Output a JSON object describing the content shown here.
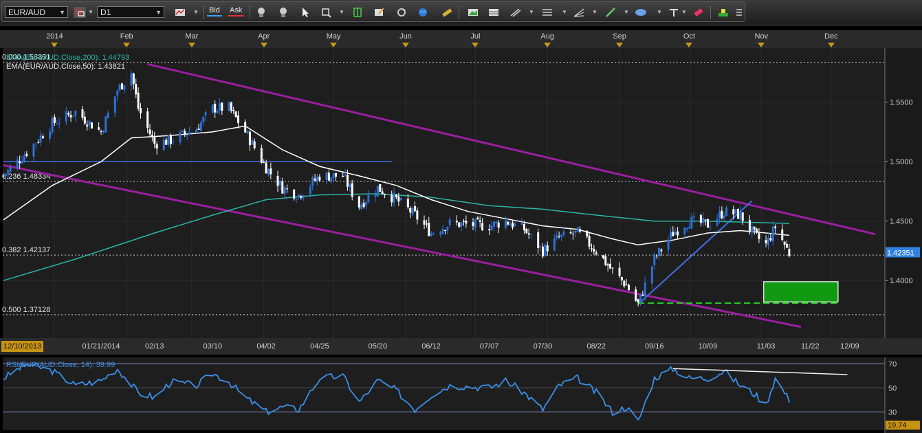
{
  "toolbar": {
    "symbol": "EUR/AUD",
    "timeframe": "D1",
    "bid_label": "Bid",
    "ask_label": "Ask"
  },
  "top_axis": {
    "months": [
      "2014",
      "Feb",
      "Mar",
      "Apr",
      "May",
      "Jun",
      "Jul",
      "Aug",
      "Sep",
      "Oct",
      "Nov",
      "Dec"
    ]
  },
  "bottom_axis": {
    "first_date": "12/10/2013",
    "dates": [
      "01/21/2014",
      "02/13",
      "03/10",
      "04/02",
      "04/25",
      "05/20",
      "06/12",
      "07/07",
      "07/30",
      "08/22",
      "09/16",
      "10/09",
      "11/03",
      "11/22",
      "12/09"
    ]
  },
  "colors": {
    "bull_candle": "#2d6fd6",
    "bear_candle": "#ffffff",
    "ema_50": "#ffffff",
    "ema_200": "#2bb5a8",
    "channel": "#9b1ea0",
    "trendline": "#3f6fe6",
    "rsi": "#3a8fe8",
    "target_box": "#119a11",
    "target_line": "#22cc22",
    "price_tag": "#2f82e0",
    "rsi_tag": "#c79313"
  },
  "chart_data": [
    {
      "type": "candlestick",
      "symbol": "EUR/AUD",
      "timeframe": "D1",
      "ylim": [
        1.355,
        1.592
      ],
      "y_ticks": [
        1.4,
        1.45,
        1.5,
        1.55
      ],
      "y_tick_labels": [
        "1.4000",
        "1.4500",
        "1.5000",
        "1.5500"
      ],
      "last_price": 1.42351,
      "last_price_label": "1.42351",
      "indicators": [
        {
          "name": "EMA(EUR/AUD.Close,200)",
          "label": "EMA(EUR/AUD.Close,200): 1.44793",
          "last": 1.44793
        },
        {
          "name": "EMA(EUR/AUD.Close,50)",
          "label": "EMA(EUR/AUD.Close,50): 1.43821",
          "last": 1.43821
        }
      ],
      "fib_levels": [
        {
          "label": "0.000 1.58351",
          "value": 1.58351
        },
        {
          "label": "0.236 1.48334",
          "value": 1.48334
        },
        {
          "label": "0.382 1.42137",
          "value": 1.42137
        },
        {
          "label": "0.500 1.37128",
          "value": 1.37128
        }
      ],
      "close_path": [
        [
          "2013-12-10",
          1.488
        ],
        [
          "2013-12-20",
          1.508
        ],
        [
          "2013-12-31",
          1.532
        ],
        [
          "2014-01-10",
          1.542
        ],
        [
          "2014-01-21",
          1.525
        ],
        [
          "2014-01-28",
          1.56
        ],
        [
          "2014-02-03",
          1.575
        ],
        [
          "2014-02-06",
          1.545
        ],
        [
          "2014-02-13",
          1.515
        ],
        [
          "2014-02-20",
          1.518
        ],
        [
          "2014-03-03",
          1.528
        ],
        [
          "2014-03-10",
          1.545
        ],
        [
          "2014-03-17",
          1.545
        ],
        [
          "2014-03-24",
          1.525
        ],
        [
          "2014-04-02",
          1.495
        ],
        [
          "2014-04-09",
          1.478
        ],
        [
          "2014-04-16",
          1.472
        ],
        [
          "2014-04-25",
          1.488
        ],
        [
          "2014-05-05",
          1.488
        ],
        [
          "2014-05-12",
          1.463
        ],
        [
          "2014-05-20",
          1.478
        ],
        [
          "2014-05-28",
          1.468
        ],
        [
          "2014-06-05",
          1.455
        ],
        [
          "2014-06-12",
          1.44
        ],
        [
          "2014-06-20",
          1.448
        ],
        [
          "2014-07-07",
          1.446
        ],
        [
          "2014-07-14",
          1.45
        ],
        [
          "2014-07-22",
          1.443
        ],
        [
          "2014-07-30",
          1.425
        ],
        [
          "2014-08-06",
          1.436
        ],
        [
          "2014-08-14",
          1.44
        ],
        [
          "2014-08-22",
          1.425
        ],
        [
          "2014-08-29",
          1.408
        ],
        [
          "2014-09-04",
          1.396
        ],
        [
          "2014-09-09",
          1.38
        ],
        [
          "2014-09-16",
          1.418
        ],
        [
          "2014-09-24",
          1.44
        ],
        [
          "2014-10-01",
          1.45
        ],
        [
          "2014-10-09",
          1.447
        ],
        [
          "2014-10-16",
          1.458
        ],
        [
          "2014-10-23",
          1.455
        ],
        [
          "2014-10-29",
          1.438
        ],
        [
          "2014-11-03",
          1.43
        ],
        [
          "2014-11-07",
          1.445
        ],
        [
          "2014-11-13",
          1.423
        ]
      ],
      "ema50_path": [
        [
          "2013-12-10",
          1.451
        ],
        [
          "2013-12-31",
          1.48
        ],
        [
          "2014-01-21",
          1.5
        ],
        [
          "2014-02-03",
          1.52
        ],
        [
          "2014-02-20",
          1.522
        ],
        [
          "2014-03-10",
          1.525
        ],
        [
          "2014-03-24",
          1.53
        ],
        [
          "2014-04-09",
          1.51
        ],
        [
          "2014-04-25",
          1.496
        ],
        [
          "2014-05-12",
          1.488
        ],
        [
          "2014-05-28",
          1.48
        ],
        [
          "2014-06-12",
          1.468
        ],
        [
          "2014-06-28",
          1.458
        ],
        [
          "2014-07-14",
          1.452
        ],
        [
          "2014-07-30",
          1.446
        ],
        [
          "2014-08-14",
          1.443
        ],
        [
          "2014-08-29",
          1.435
        ],
        [
          "2014-09-09",
          1.43
        ],
        [
          "2014-09-24",
          1.434
        ],
        [
          "2014-10-09",
          1.44
        ],
        [
          "2014-10-23",
          1.442
        ],
        [
          "2014-11-03",
          1.44
        ],
        [
          "2014-11-13",
          1.438
        ]
      ],
      "ema200_path": [
        [
          "2013-12-10",
          1.4
        ],
        [
          "2014-01-10",
          1.418
        ],
        [
          "2014-02-13",
          1.44
        ],
        [
          "2014-03-10",
          1.455
        ],
        [
          "2014-04-02",
          1.468
        ],
        [
          "2014-04-25",
          1.472
        ],
        [
          "2014-05-20",
          1.473
        ],
        [
          "2014-06-12",
          1.47
        ],
        [
          "2014-07-07",
          1.463
        ],
        [
          "2014-07-30",
          1.46
        ],
        [
          "2014-08-22",
          1.455
        ],
        [
          "2014-09-16",
          1.45
        ],
        [
          "2014-10-09",
          1.45
        ],
        [
          "2014-11-13",
          1.448
        ]
      ],
      "channel_lines": [
        {
          "from": [
            "2014-02-10",
            1.582
          ],
          "to": [
            "2014-12-20",
            1.439
          ]
        },
        {
          "from": [
            "2013-12-10",
            1.497
          ],
          "to": [
            "2014-11-18",
            1.361
          ]
        }
      ],
      "horizontal_line": {
        "from": [
          "2013-12-10",
          1.5
        ],
        "to": [
          "2014-05-26",
          1.5
        ]
      },
      "trendline": {
        "from": [
          "2014-09-09",
          1.38
        ],
        "to": [
          "2014-10-28",
          1.467
        ]
      },
      "target_zone": {
        "x": [
          "2014-11-02",
          "2014-12-04"
        ],
        "y": [
          1.382,
          1.399
        ]
      },
      "target_line": {
        "x": [
          "2014-09-09",
          "2014-12-05"
        ],
        "y": 1.381
      }
    },
    {
      "type": "line",
      "indicator": "RSI(EUR/AUD.Close, 14)",
      "label": "RSI(EUR/AUD.Close, 14): 39.99",
      "last": 39.99,
      "ylim": [
        17,
        73
      ],
      "levels": [
        70,
        50,
        30
      ],
      "level_labels": [
        "70",
        "50",
        "30"
      ],
      "min_label": "19.74",
      "rsi_path": [
        [
          "2013-12-10",
          58
        ],
        [
          "2013-12-20",
          70
        ],
        [
          "2013-12-31",
          64
        ],
        [
          "2014-01-10",
          52
        ],
        [
          "2014-01-21",
          56
        ],
        [
          "2014-01-28",
          66
        ],
        [
          "2014-02-06",
          46
        ],
        [
          "2014-02-13",
          42
        ],
        [
          "2014-02-20",
          55
        ],
        [
          "2014-03-03",
          52
        ],
        [
          "2014-03-10",
          62
        ],
        [
          "2014-03-17",
          55
        ],
        [
          "2014-03-24",
          42
        ],
        [
          "2014-04-02",
          30
        ],
        [
          "2014-04-09",
          34
        ],
        [
          "2014-04-16",
          32
        ],
        [
          "2014-04-25",
          58
        ],
        [
          "2014-05-05",
          60
        ],
        [
          "2014-05-12",
          38
        ],
        [
          "2014-05-20",
          56
        ],
        [
          "2014-05-28",
          48
        ],
        [
          "2014-06-05",
          32
        ],
        [
          "2014-06-12",
          44
        ],
        [
          "2014-06-20",
          52
        ],
        [
          "2014-07-07",
          50
        ],
        [
          "2014-07-14",
          56
        ],
        [
          "2014-07-22",
          46
        ],
        [
          "2014-07-30",
          32
        ],
        [
          "2014-08-06",
          52
        ],
        [
          "2014-08-14",
          58
        ],
        [
          "2014-08-22",
          46
        ],
        [
          "2014-08-29",
          30
        ],
        [
          "2014-09-04",
          34
        ],
        [
          "2014-09-09",
          22
        ],
        [
          "2014-09-16",
          58
        ],
        [
          "2014-09-24",
          66
        ],
        [
          "2014-10-01",
          58
        ],
        [
          "2014-10-09",
          58
        ],
        [
          "2014-10-16",
          64
        ],
        [
          "2014-10-23",
          52
        ],
        [
          "2014-10-29",
          45
        ],
        [
          "2014-11-03",
          36
        ],
        [
          "2014-11-07",
          58
        ],
        [
          "2014-11-13",
          40
        ]
      ],
      "divergence_line": {
        "from": [
          "2014-09-24",
          66
        ],
        "to": [
          "2014-12-08",
          61
        ]
      }
    }
  ]
}
